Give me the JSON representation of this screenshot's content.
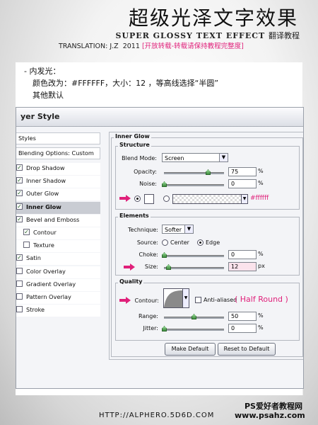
{
  "header": {
    "title_cn": "超级光泽文字效果",
    "title_en": "SUPER GLOSSY TEXT EFFECT",
    "title_en_suffix": "翻译教程",
    "translation": "TRANSLATION: J.Z",
    "year": "2011",
    "notice": "[开放转载-转载请保持教程完整度]"
  },
  "instructions": {
    "line1": "- 内发光：",
    "line2": "颜色改为：#FFFFFF，大小：12 ，等高线选择“半圆”",
    "line3": "其他默认"
  },
  "dialog": {
    "title": "yer Style",
    "styles_header": "Styles",
    "blending": "Blending Options: Custom",
    "items": [
      {
        "label": "Drop Shadow",
        "checked": true
      },
      {
        "label": "Inner Shadow",
        "checked": true
      },
      {
        "label": "Outer Glow",
        "checked": true
      },
      {
        "label": "Inner Glow",
        "checked": true,
        "selected": true
      },
      {
        "label": "Bevel and Emboss",
        "checked": true
      },
      {
        "label": "Contour",
        "checked": true,
        "indent": true
      },
      {
        "label": "Texture",
        "checked": false,
        "indent": true
      },
      {
        "label": "Satin",
        "checked": true
      },
      {
        "label": "Color Overlay",
        "checked": false
      },
      {
        "label": "Gradient Overlay",
        "checked": false
      },
      {
        "label": "Pattern Overlay",
        "checked": false
      },
      {
        "label": "Stroke",
        "checked": false
      }
    ],
    "panel_title": "Inner Glow",
    "structure": {
      "title": "Structure",
      "blend_mode_label": "Blend Mode:",
      "blend_mode": "Screen",
      "opacity_label": "Opacity:",
      "opacity": "75",
      "noise_label": "Noise:",
      "noise": "0",
      "percent": "%",
      "color_note": "#ffffff"
    },
    "elements": {
      "title": "Elements",
      "technique_label": "Technique:",
      "technique": "Softer",
      "source_label": "Source:",
      "source_center": "Center",
      "source_edge": "Edge",
      "choke_label": "Choke:",
      "choke": "0",
      "size_label": "Size:",
      "size": "12",
      "px": "px",
      "percent": "%"
    },
    "quality": {
      "title": "Quality",
      "contour_label": "Contour:",
      "anti_aliased": "Anti-aliased",
      "contour_note": "( Half Round )",
      "range_label": "Range:",
      "range": "50",
      "jitter_label": "Jitter:",
      "jitter": "0",
      "percent": "%"
    },
    "make_default": "Make Default",
    "reset_default": "Reset to Default"
  },
  "footer": {
    "url": "HTTP://ALPHERO.5D6D.COM",
    "watermark_cn": "PS爱好者教程网",
    "watermark_url": "www.psahz.com"
  },
  "colors": {
    "accent_pink": "#e0207a",
    "check_green": "#1a5a1a"
  }
}
